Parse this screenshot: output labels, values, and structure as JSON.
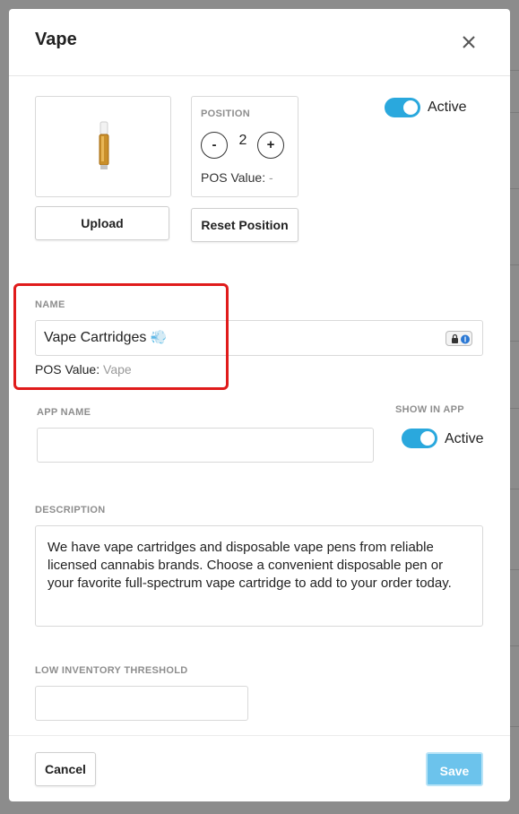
{
  "modal": {
    "title": "Vape"
  },
  "image_section": {
    "upload_label": "Upload"
  },
  "position": {
    "label": "POSITION",
    "minus_label": "-",
    "value": "2",
    "plus_label": "+",
    "pos_value_label": "POS Value:",
    "pos_value": "-",
    "reset_label": "Reset Position"
  },
  "active_toggle": {
    "label": "Active",
    "on": true
  },
  "name": {
    "label": "NAME",
    "value": "Vape Cartridges",
    "emoji": "💨",
    "pos_value_label": "POS Value:",
    "pos_value": "Vape"
  },
  "app_name": {
    "label": "APP NAME",
    "value": ""
  },
  "show_in_app": {
    "label": "SHOW IN APP",
    "toggle_label": "Active",
    "on": true
  },
  "description": {
    "label": "DESCRIPTION",
    "value": "We have vape cartridges and disposable vape pens from reliable licensed cannabis brands. Choose a convenient disposable pen or your favorite full-spectrum vape cartridge to add to your order today."
  },
  "low_inventory": {
    "label": "LOW INVENTORY THRESHOLD",
    "value": ""
  },
  "footer": {
    "cancel_label": "Cancel",
    "save_label": "Save"
  },
  "colors": {
    "accent": "#2aa8dd",
    "save_bg": "#6cc3ec",
    "highlight": "#e01b1b",
    "overlay": "#8a8a8a"
  },
  "icons": {
    "close": "close-icon",
    "product_image": "vape-cartridge-image",
    "password_manager": "password-manager-icon"
  }
}
